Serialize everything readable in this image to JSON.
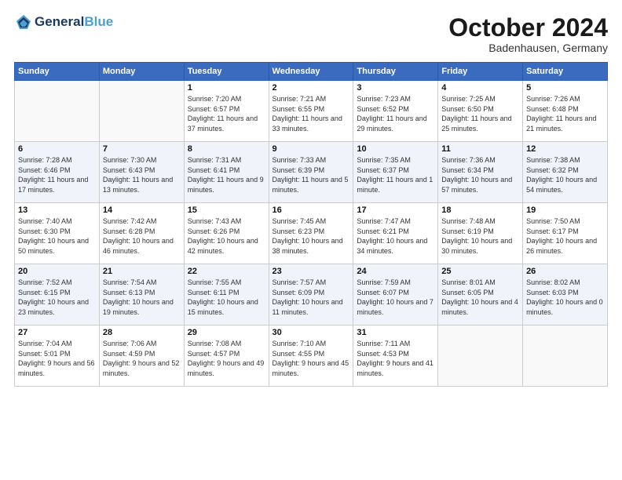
{
  "header": {
    "logo_line1": "General",
    "logo_line2": "Blue",
    "month_title": "October 2024",
    "subtitle": "Badenhausen, Germany"
  },
  "days_of_week": [
    "Sunday",
    "Monday",
    "Tuesday",
    "Wednesday",
    "Thursday",
    "Friday",
    "Saturday"
  ],
  "weeks": [
    [
      {
        "day": "",
        "info": ""
      },
      {
        "day": "",
        "info": ""
      },
      {
        "day": "1",
        "info": "Sunrise: 7:20 AM\nSunset: 6:57 PM\nDaylight: 11 hours\nand 37 minutes."
      },
      {
        "day": "2",
        "info": "Sunrise: 7:21 AM\nSunset: 6:55 PM\nDaylight: 11 hours\nand 33 minutes."
      },
      {
        "day": "3",
        "info": "Sunrise: 7:23 AM\nSunset: 6:52 PM\nDaylight: 11 hours\nand 29 minutes."
      },
      {
        "day": "4",
        "info": "Sunrise: 7:25 AM\nSunset: 6:50 PM\nDaylight: 11 hours\nand 25 minutes."
      },
      {
        "day": "5",
        "info": "Sunrise: 7:26 AM\nSunset: 6:48 PM\nDaylight: 11 hours\nand 21 minutes."
      }
    ],
    [
      {
        "day": "6",
        "info": "Sunrise: 7:28 AM\nSunset: 6:46 PM\nDaylight: 11 hours\nand 17 minutes."
      },
      {
        "day": "7",
        "info": "Sunrise: 7:30 AM\nSunset: 6:43 PM\nDaylight: 11 hours\nand 13 minutes."
      },
      {
        "day": "8",
        "info": "Sunrise: 7:31 AM\nSunset: 6:41 PM\nDaylight: 11 hours\nand 9 minutes."
      },
      {
        "day": "9",
        "info": "Sunrise: 7:33 AM\nSunset: 6:39 PM\nDaylight: 11 hours\nand 5 minutes."
      },
      {
        "day": "10",
        "info": "Sunrise: 7:35 AM\nSunset: 6:37 PM\nDaylight: 11 hours\nand 1 minute."
      },
      {
        "day": "11",
        "info": "Sunrise: 7:36 AM\nSunset: 6:34 PM\nDaylight: 10 hours\nand 57 minutes."
      },
      {
        "day": "12",
        "info": "Sunrise: 7:38 AM\nSunset: 6:32 PM\nDaylight: 10 hours\nand 54 minutes."
      }
    ],
    [
      {
        "day": "13",
        "info": "Sunrise: 7:40 AM\nSunset: 6:30 PM\nDaylight: 10 hours\nand 50 minutes."
      },
      {
        "day": "14",
        "info": "Sunrise: 7:42 AM\nSunset: 6:28 PM\nDaylight: 10 hours\nand 46 minutes."
      },
      {
        "day": "15",
        "info": "Sunrise: 7:43 AM\nSunset: 6:26 PM\nDaylight: 10 hours\nand 42 minutes."
      },
      {
        "day": "16",
        "info": "Sunrise: 7:45 AM\nSunset: 6:23 PM\nDaylight: 10 hours\nand 38 minutes."
      },
      {
        "day": "17",
        "info": "Sunrise: 7:47 AM\nSunset: 6:21 PM\nDaylight: 10 hours\nand 34 minutes."
      },
      {
        "day": "18",
        "info": "Sunrise: 7:48 AM\nSunset: 6:19 PM\nDaylight: 10 hours\nand 30 minutes."
      },
      {
        "day": "19",
        "info": "Sunrise: 7:50 AM\nSunset: 6:17 PM\nDaylight: 10 hours\nand 26 minutes."
      }
    ],
    [
      {
        "day": "20",
        "info": "Sunrise: 7:52 AM\nSunset: 6:15 PM\nDaylight: 10 hours\nand 23 minutes."
      },
      {
        "day": "21",
        "info": "Sunrise: 7:54 AM\nSunset: 6:13 PM\nDaylight: 10 hours\nand 19 minutes."
      },
      {
        "day": "22",
        "info": "Sunrise: 7:55 AM\nSunset: 6:11 PM\nDaylight: 10 hours\nand 15 minutes."
      },
      {
        "day": "23",
        "info": "Sunrise: 7:57 AM\nSunset: 6:09 PM\nDaylight: 10 hours\nand 11 minutes."
      },
      {
        "day": "24",
        "info": "Sunrise: 7:59 AM\nSunset: 6:07 PM\nDaylight: 10 hours\nand 7 minutes."
      },
      {
        "day": "25",
        "info": "Sunrise: 8:01 AM\nSunset: 6:05 PM\nDaylight: 10 hours\nand 4 minutes."
      },
      {
        "day": "26",
        "info": "Sunrise: 8:02 AM\nSunset: 6:03 PM\nDaylight: 10 hours\nand 0 minutes."
      }
    ],
    [
      {
        "day": "27",
        "info": "Sunrise: 7:04 AM\nSunset: 5:01 PM\nDaylight: 9 hours\nand 56 minutes."
      },
      {
        "day": "28",
        "info": "Sunrise: 7:06 AM\nSunset: 4:59 PM\nDaylight: 9 hours\nand 52 minutes."
      },
      {
        "day": "29",
        "info": "Sunrise: 7:08 AM\nSunset: 4:57 PM\nDaylight: 9 hours\nand 49 minutes."
      },
      {
        "day": "30",
        "info": "Sunrise: 7:10 AM\nSunset: 4:55 PM\nDaylight: 9 hours\nand 45 minutes."
      },
      {
        "day": "31",
        "info": "Sunrise: 7:11 AM\nSunset: 4:53 PM\nDaylight: 9 hours\nand 41 minutes."
      },
      {
        "day": "",
        "info": ""
      },
      {
        "day": "",
        "info": ""
      }
    ]
  ]
}
